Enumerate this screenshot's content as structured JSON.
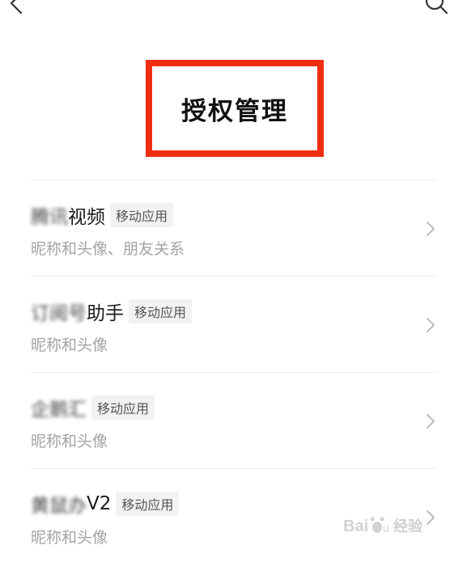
{
  "header": {
    "title": "授权管理"
  },
  "apps": [
    {
      "name_blurred": "腾讯",
      "name_visible": "视频",
      "badge": "移动应用",
      "permissions": "昵称和头像、朋友关系"
    },
    {
      "name_blurred": "订阅号",
      "name_visible": "助手",
      "badge": "移动应用",
      "permissions": "昵称和头像"
    },
    {
      "name_blurred": "企鹅汇",
      "name_visible": "",
      "badge": "移动应用",
      "permissions": "昵称和头像"
    },
    {
      "name_blurred": "黄鼠办",
      "name_visible": "V2",
      "badge": "移动应用",
      "permissions": "昵称和头像"
    }
  ],
  "watermark": {
    "text": "经验"
  },
  "colors": {
    "highlight": "#f02d12",
    "title": "#111111",
    "permissions": "#a4a4a4",
    "badge_bg": "#f2f2f2"
  }
}
